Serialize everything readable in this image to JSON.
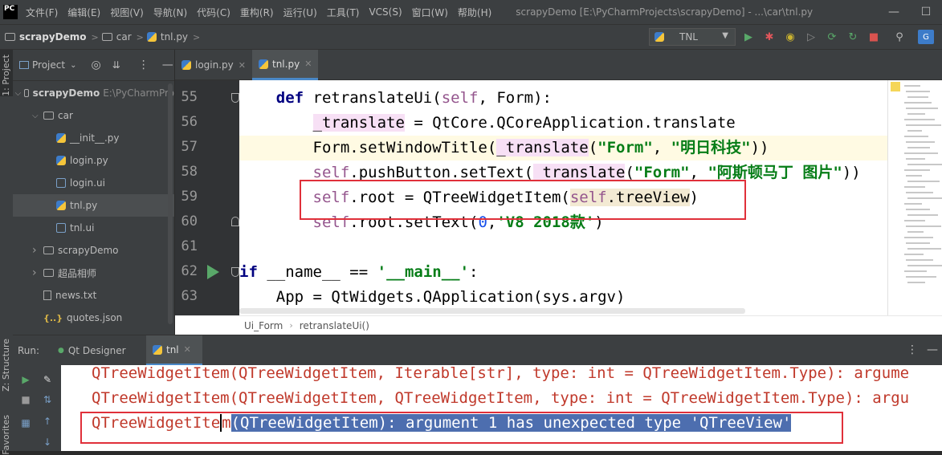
{
  "app": {
    "logo_text": "PC",
    "menu": [
      "文件(F)",
      "编辑(E)",
      "视图(V)",
      "导航(N)",
      "代码(C)",
      "重构(R)",
      "运行(U)",
      "工具(T)",
      "VCS(S)",
      "窗口(W)",
      "帮助(H)"
    ],
    "window_title": "scrapyDemo [E:\\PyCharmProjects\\scrapyDemo] - ...\\car\\tnl.py"
  },
  "navbar": {
    "project": "scrapyDemo",
    "folder": "car",
    "file": "tnl.py",
    "run_config": "TNL"
  },
  "side_tabs": {
    "project": "1: Project",
    "structure": "Z: Structure",
    "favorites": "Favorites"
  },
  "project_panel": {
    "title": "Project",
    "items": [
      {
        "label": "scrapyDemo",
        "hint": "E:\\PyCharmPro",
        "type": "folder",
        "indent": 0,
        "expanded": true
      },
      {
        "label": "car",
        "type": "folder",
        "indent": 1,
        "expanded": true
      },
      {
        "label": "__init__.py",
        "type": "py",
        "indent": 2
      },
      {
        "label": "login.py",
        "type": "py",
        "indent": 2
      },
      {
        "label": "login.ui",
        "type": "ui",
        "indent": 2
      },
      {
        "label": "tnl.py",
        "type": "py",
        "indent": 2,
        "selected": true
      },
      {
        "label": "tnl.ui",
        "type": "ui",
        "indent": 2
      },
      {
        "label": "scrapyDemo",
        "type": "folder",
        "indent": 1,
        "expanded": false
      },
      {
        "label": "超品相师",
        "type": "folder",
        "indent": 1,
        "expanded": false
      },
      {
        "label": "news.txt",
        "type": "txt",
        "indent": 1
      },
      {
        "label": "quotes.json",
        "type": "json",
        "indent": 1
      }
    ]
  },
  "editor": {
    "tabs": [
      {
        "label": "login.py",
        "active": false
      },
      {
        "label": "tnl.py",
        "active": true
      }
    ],
    "line_numbers": [
      "55",
      "56",
      "57",
      "58",
      "59",
      "60",
      "61",
      "62",
      "63"
    ],
    "code": {
      "l55_def": "def",
      "l55_name": " retranslateUi(",
      "l55_self": "self",
      "l55_rest": ", Form):",
      "l56_var": "_translate",
      "l56_rest": " = QtCore.QCoreApplication.translate",
      "l57_a": "Form.setWindowTitle(",
      "l57_var": "_translate",
      "l57_b": "(",
      "l57_s1": "\"Form\"",
      "l57_c": ", ",
      "l57_s2": "\"明日科技\"",
      "l57_d": "))",
      "l58_self": "self",
      "l58_a": ".pushButton.setText(",
      "l58_var": "_translate",
      "l58_b": "(",
      "l58_s1": "\"Form\"",
      "l58_c": ", ",
      "l58_s2": "\"阿斯顿马丁 图片\"",
      "l58_d": "))",
      "l59_self": "self",
      "l59_a": ".root = QTreeWidgetItem(",
      "l59_self2": "self",
      "l59_b": ".treeView",
      "l59_c": ")",
      "l60_self": "self",
      "l60_a": ".root.setText(",
      "l60_num": "0",
      "l60_b": ",",
      "l60_str": "'V8 2018款'",
      "l60_c": ")",
      "l62_if": "if",
      "l62_a": " ",
      "l62_name": "__name__",
      "l62_b": " == ",
      "l62_str": "'__main__'",
      "l62_c": ":",
      "l63": "    App = QtWidgets.QApplication(sys.argv)"
    },
    "breadcrumb": [
      "Ui_Form",
      "retranslateUi()"
    ]
  },
  "run_panel": {
    "label": "Run:",
    "tabs": [
      {
        "label": "Qt Designer",
        "active": false
      },
      {
        "label": "tnl",
        "active": true
      }
    ],
    "console": {
      "line1": "QTreeWidgetItem(QTreeWidgetItem, Iterable[str], type: int = QTreeWidgetItem.Type): argume",
      "line2": "QTreeWidgetItem(QTreeWidgetItem, QTreeWidgetItem, type: int = QTreeWidgetItem.Type): argu",
      "line3_plain": "QTreeWidgetIte",
      "line3_sel_start": "m",
      "line3_selected": "(QTreeWidgetItem): argument 1 has unexpected type 'QTreeView'"
    }
  }
}
